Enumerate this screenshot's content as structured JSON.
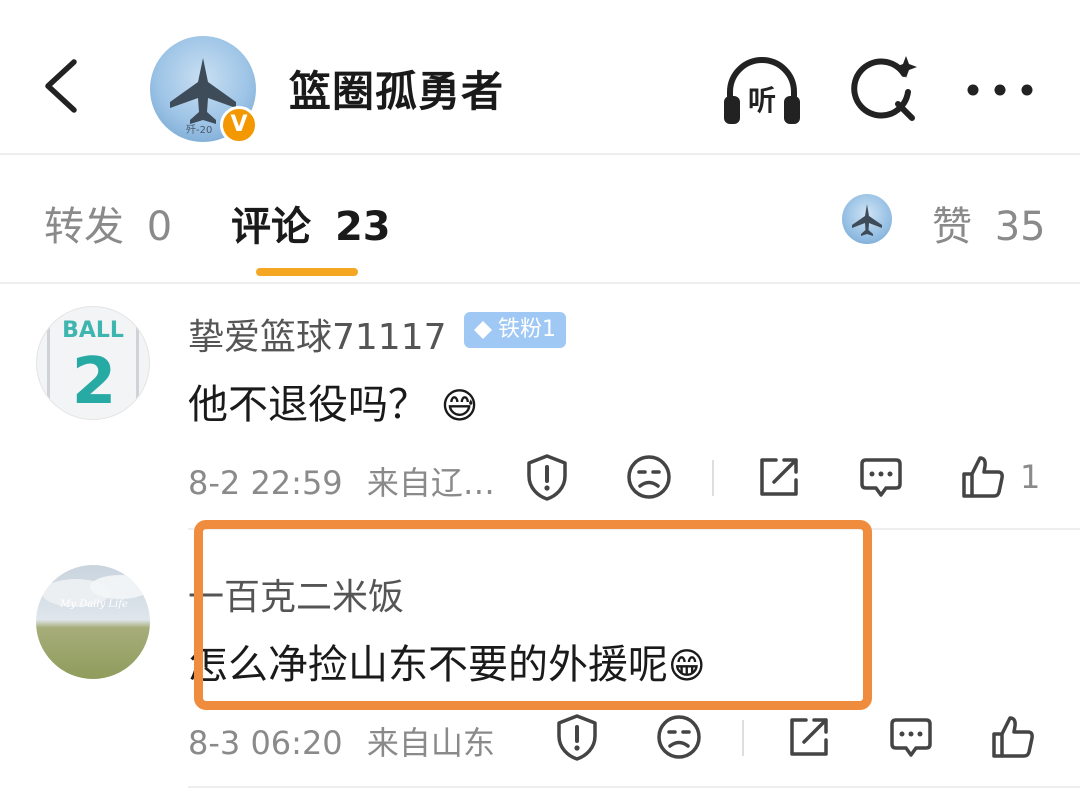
{
  "header": {
    "title": "篮圈孤勇者",
    "avatar_caption": "歼-20",
    "verified_badge": "V",
    "listen_label": "听"
  },
  "tabs": [
    {
      "label": "转发",
      "count": "0"
    },
    {
      "label": "评论",
      "count": "23"
    },
    {
      "label": "赞",
      "count": "35"
    }
  ],
  "comments": [
    {
      "username": "挚爱篮球71117",
      "badge": "铁粉1",
      "avatar_text": "BALL",
      "avatar_number": "2",
      "text": "他不退役吗？",
      "emoji": "😅",
      "time": "8-2 22:59",
      "source": "来自辽…",
      "likes": "1"
    },
    {
      "username": "一百克二米饭",
      "avatar_text": "My Daily Life",
      "text": "怎么净捡山东不要的外援呢",
      "emoji": "😁",
      "time": "8-3 06:20",
      "source": "来自山东",
      "likes": ""
    }
  ],
  "colors": {
    "accent": "#f5a623",
    "highlight": "#ef8c3d",
    "badge": "#9fc8f5",
    "verified": "#f39800"
  }
}
